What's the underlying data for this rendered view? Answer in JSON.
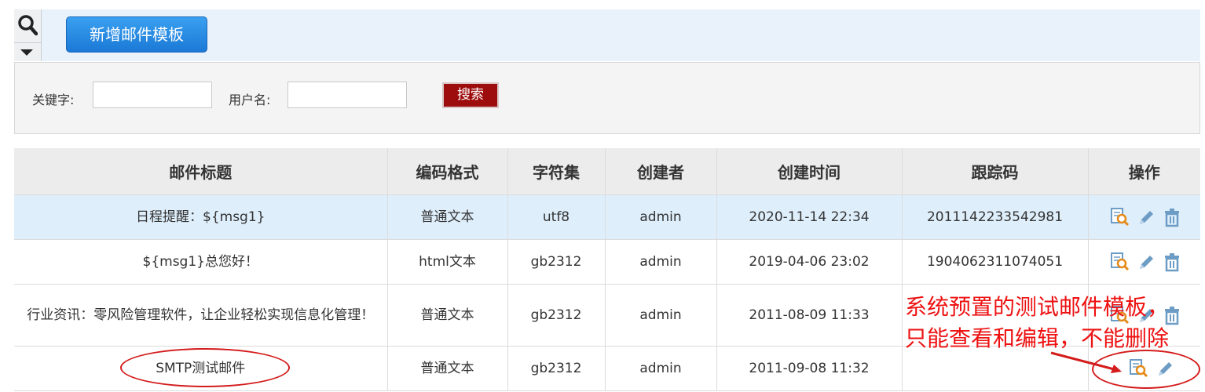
{
  "toolbar": {
    "add_button_label": "新增邮件模板",
    "search_icon": "search-icon",
    "dropdown_icon": "caret-down-icon"
  },
  "search": {
    "keyword_label": "关键字:",
    "keyword_value": "",
    "username_label": "用户名:",
    "username_value": "",
    "search_button_label": "搜索"
  },
  "table": {
    "headers": [
      "邮件标题",
      "编码格式",
      "字符集",
      "创建者",
      "创建时间",
      "跟踪码",
      "操作"
    ],
    "rows": [
      {
        "title": "日程提醒：${msg1}",
        "format": "普通文本",
        "charset": "utf8",
        "creator": "admin",
        "created": "2020-11-14 22:34",
        "tracking": "2011142233542981",
        "actions": [
          "view-icon",
          "edit-icon",
          "delete-icon"
        ]
      },
      {
        "title": "${msg1}总您好！",
        "format": "html文本",
        "charset": "gb2312",
        "creator": "admin",
        "created": "2019-04-06 23:02",
        "tracking": "1904062311074051",
        "actions": [
          "view-icon",
          "edit-icon",
          "delete-icon"
        ]
      },
      {
        "title": "行业资讯：零风险管理软件，让企业轻松实现信息化管理！",
        "format": "普通文本",
        "charset": "gb2312",
        "creator": "admin",
        "created": "2011-08-09 11:33",
        "tracking": "",
        "actions": [
          "view-icon",
          "edit-icon",
          "delete-icon"
        ]
      },
      {
        "title": "SMTP测试邮件",
        "format": "普通文本",
        "charset": "gb2312",
        "creator": "admin",
        "created": "2011-09-08 11:32",
        "tracking": "",
        "actions": [
          "view-icon",
          "edit-icon"
        ]
      }
    ]
  },
  "annotation": {
    "text": "系统预置的测试邮件模板，只能查看和编辑，不能删除",
    "color": "#ee1111"
  },
  "colors": {
    "add_button": "#1a79d6",
    "search_button": "#9e0d0d",
    "selected_row": "#deeefb",
    "icon_blue": "#6d9cc4",
    "icon_orange": "#e58a19"
  }
}
